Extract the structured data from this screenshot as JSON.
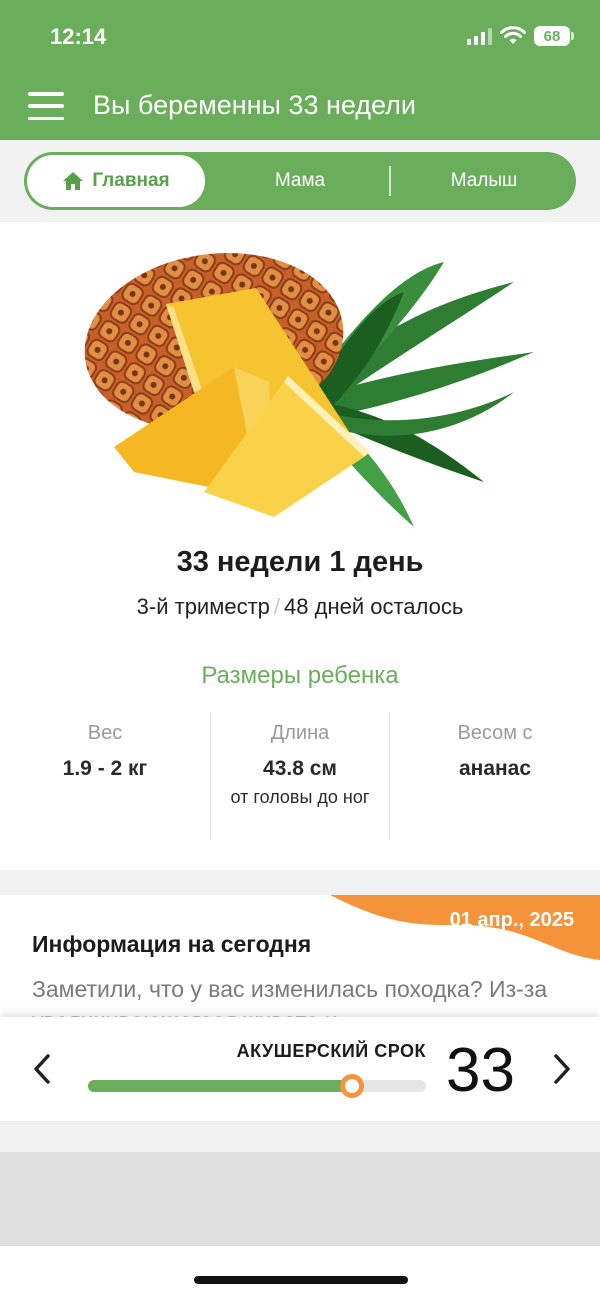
{
  "status_bar": {
    "time": "12:14",
    "battery": "68"
  },
  "header": {
    "title": "Вы беременны 33 недели",
    "menu_icon": "hamburger-icon"
  },
  "tabs": [
    {
      "label": "Главная",
      "icon": "home-icon",
      "active": true
    },
    {
      "label": "Мама",
      "active": false
    },
    {
      "label": "Малыш",
      "active": false
    }
  ],
  "pregnancy": {
    "image": "pineapple-illustration",
    "week_title": "33 недели 1 день",
    "trimester": "3-й триместр",
    "separator": "/",
    "days_left": "48 дней осталось",
    "sizes_title": "Размеры ребенка",
    "stats": [
      {
        "label": "Вес",
        "value": "1.9 - 2 кг"
      },
      {
        "label": "Длина",
        "value": "43.8 см",
        "note": "от головы до ног"
      },
      {
        "label": "Весом с",
        "value": "ананас"
      }
    ]
  },
  "info": {
    "date": "01 апр., 2025",
    "title": "Информация на сегодня",
    "text": "Заметили, что у вас изменилась походка? Из-за увеличивающегося живота и"
  },
  "term": {
    "label": "АКУШЕРСКИЙ СРОК",
    "week": "33",
    "progress_fraction": 0.78
  },
  "colors": {
    "primary": "#6aae5c",
    "accent": "#f5933a"
  }
}
